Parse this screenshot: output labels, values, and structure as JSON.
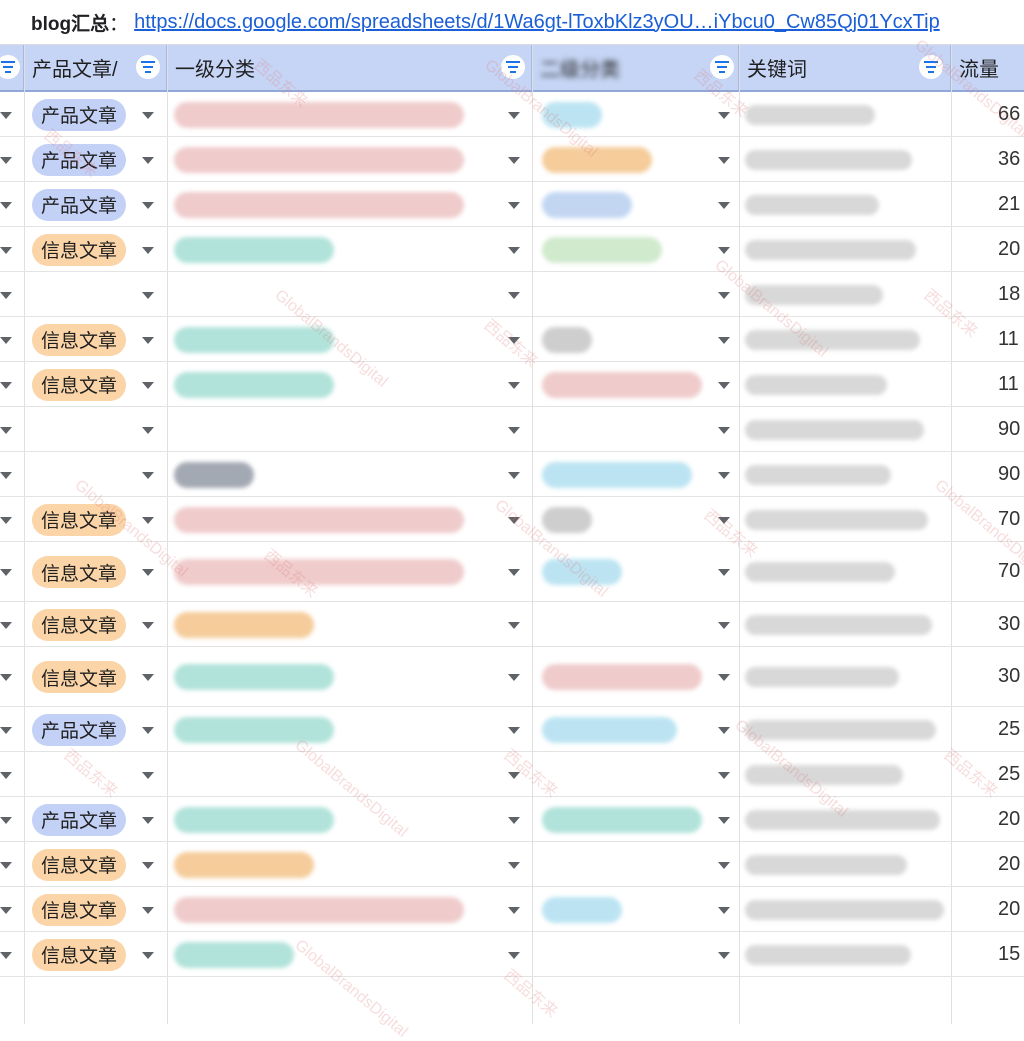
{
  "topbar": {
    "label": "blog汇总",
    "colon": "：",
    "url": "https://docs.google.com/spreadsheets/d/1Wa6gt-lToxbKlz3yOU…iYbcu0_Cw85Qj01YcxTip"
  },
  "columns": {
    "type": "产品文章/",
    "cat1": "一级分类",
    "cat2": "二级分类",
    "keyword": "关键词",
    "traffic": "流量"
  },
  "rows": [
    {
      "type": "产品文章",
      "traffic": "66"
    },
    {
      "type": "产品文章",
      "traffic": "36"
    },
    {
      "type": "产品文章",
      "traffic": "21"
    },
    {
      "type": "信息文章",
      "traffic": "20"
    },
    {
      "type": "",
      "traffic": "18"
    },
    {
      "type": "信息文章",
      "traffic": "11"
    },
    {
      "type": "信息文章",
      "traffic": "11"
    },
    {
      "type": "",
      "traffic": "90"
    },
    {
      "type": "",
      "traffic": "90"
    },
    {
      "type": "信息文章",
      "traffic": "70"
    },
    {
      "type": "信息文章",
      "traffic": "70"
    },
    {
      "type": "信息文章",
      "traffic": "30"
    },
    {
      "type": "信息文章",
      "traffic": "30"
    },
    {
      "type": "产品文章",
      "traffic": "25"
    },
    {
      "type": "",
      "traffic": "25"
    },
    {
      "type": "产品文章",
      "traffic": "20"
    },
    {
      "type": "信息文章",
      "traffic": "20"
    },
    {
      "type": "信息文章",
      "traffic": "20"
    },
    {
      "type": "信息文章",
      "traffic": "15"
    }
  ],
  "watermark": {
    "cn": "西品东来",
    "en": "GlobalBrandsDigital"
  },
  "colors": {
    "product_chip": "#c4d1f7",
    "info_chip": "#fbd4a7",
    "header_bg": "#c6d5f5",
    "link": "#1a5fd6"
  }
}
